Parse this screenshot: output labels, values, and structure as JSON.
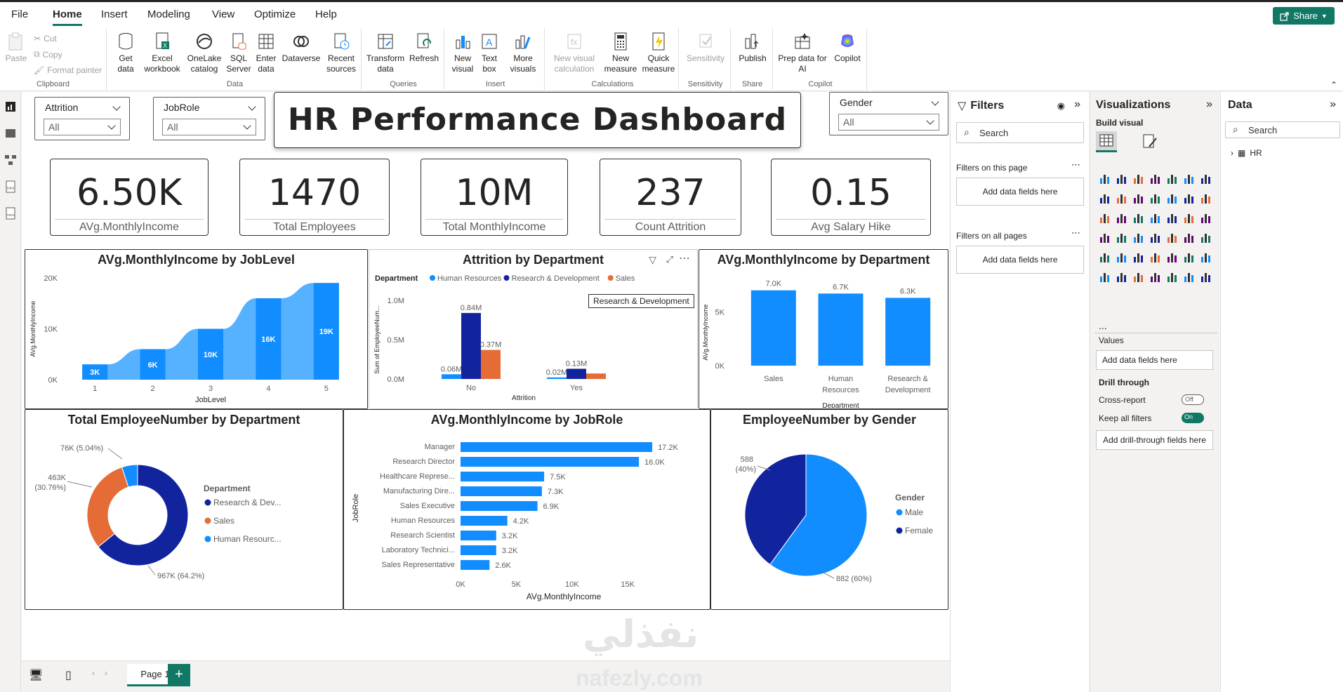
{
  "menu": {
    "items": [
      "File",
      "Home",
      "Insert",
      "Modeling",
      "View",
      "Optimize",
      "Help"
    ],
    "active": "Home",
    "share": "Share"
  },
  "ribbon": {
    "clipboard": {
      "label": "Clipboard",
      "paste": "Paste",
      "cut": "Cut",
      "copy": "Copy",
      "format_painter": "Format painter"
    },
    "data": {
      "label": "Data",
      "get_data": "Get data",
      "excel": "Excel workbook",
      "onelake": "OneLake catalog",
      "sql": "SQL Server",
      "enter": "Enter data",
      "dataverse": "Dataverse",
      "recent": "Recent sources"
    },
    "queries": {
      "label": "Queries",
      "transform": "Transform data",
      "refresh": "Refresh"
    },
    "insert": {
      "label": "Insert",
      "new_visual": "New visual",
      "text_box": "Text box",
      "more_visuals": "More visuals"
    },
    "calculations": {
      "label": "Calculations",
      "new_visual_calc": "New visual calculation",
      "new_measure": "New measure",
      "quick_measure": "Quick measure"
    },
    "sensitivity": {
      "label": "Sensitivity",
      "sensitivity": "Sensitivity"
    },
    "share": {
      "label": "Share",
      "publish": "Publish"
    },
    "copilot": {
      "label": "Copilot",
      "prep": "Prep data for AI",
      "copilot": "Copilot"
    }
  },
  "slicers": {
    "attrition": {
      "title": "Attrition",
      "value": "All"
    },
    "jobrole": {
      "title": "JobRole",
      "value": "All"
    },
    "gender": {
      "title": "Gender",
      "value": "All"
    }
  },
  "dashboard_title": "HR Performance Dashboard",
  "kpis": [
    {
      "value": "6.50K",
      "label": "AVg.MonthlyIncome"
    },
    {
      "value": "1470",
      "label": "Total Employees"
    },
    {
      "value": "10M",
      "label": "Total MonthlyIncome"
    },
    {
      "value": "237",
      "label": "Count Attrition"
    },
    {
      "value": "0.15",
      "label": "Avg Salary Hike"
    }
  ],
  "chart_data": [
    {
      "type": "area",
      "title": "AVg.MonthlyIncome by JobLevel",
      "xlabel": "JobLevel",
      "ylabel": "AVg.MonthlyIncome",
      "categories": [
        "1",
        "2",
        "3",
        "4",
        "5"
      ],
      "values": [
        3,
        6,
        10,
        16,
        19
      ],
      "data_labels": [
        "3K",
        "6K",
        "10K",
        "16K",
        "19K"
      ],
      "yticks": [
        "0K",
        "10K",
        "20K"
      ],
      "ylim": [
        0,
        20
      ]
    },
    {
      "type": "bar",
      "title": "Attrition by Department",
      "xlabel": "Attrition",
      "ylabel": "Sum of EmployeeNum...",
      "legend_title": "Department",
      "categories": [
        "No",
        "Yes"
      ],
      "series": [
        {
          "name": "Human Resources",
          "values": [
            0.06,
            0.02
          ],
          "labels": [
            "0.06M",
            "0.02M"
          ]
        },
        {
          "name": "Research & Development",
          "values": [
            0.84,
            0.13
          ],
          "labels": [
            "0.84M",
            "0.13M"
          ]
        },
        {
          "name": "Sales",
          "values": [
            0.37,
            0.07
          ],
          "labels": [
            "0.37M",
            ""
          ]
        }
      ],
      "yticks": [
        "0.0M",
        "0.5M",
        "1.0M"
      ],
      "ylim": [
        0,
        1.0
      ],
      "tooltip": "Research & Development"
    },
    {
      "type": "bar",
      "title": "AVg.MonthlyIncome by Department",
      "xlabel": "Department",
      "ylabel": "AVg.MonthlyIncome",
      "categories": [
        "Sales",
        "Human Resources",
        "Research & Development"
      ],
      "values": [
        7.0,
        6.7,
        6.3
      ],
      "data_labels": [
        "7.0K",
        "6.7K",
        "6.3K"
      ],
      "yticks": [
        "0K",
        "5K"
      ],
      "ylim": [
        0,
        7.5
      ]
    },
    {
      "type": "pie",
      "title": "Total EmployeeNumber by Department",
      "legend_title": "Department",
      "slices": [
        {
          "name": "Research & Dev...",
          "value": 967,
          "label": "967K (64.2%)"
        },
        {
          "name": "Sales",
          "value": 463,
          "label": "463K (30.76%)"
        },
        {
          "name": "Human Resourc...",
          "value": 76,
          "label": "76K (5.04%)"
        }
      ],
      "donut": true
    },
    {
      "type": "bar",
      "title": "AVg.MonthlyIncome by JobRole",
      "xlabel": "AVg.MonthlyIncome",
      "ylabel": "JobRole",
      "orientation": "horizontal",
      "categories": [
        "Manager",
        "Research Director",
        "Healthcare Represe...",
        "Manufacturing Dire...",
        "Sales Executive",
        "Human Resources",
        "Research Scientist",
        "Laboratory Technici...",
        "Sales Representative"
      ],
      "values": [
        17.2,
        16.0,
        7.5,
        7.3,
        6.9,
        4.2,
        3.2,
        3.2,
        2.6
      ],
      "data_labels": [
        "17.2K",
        "16.0K",
        "7.5K",
        "7.3K",
        "6.9K",
        "4.2K",
        "3.2K",
        "3.2K",
        "2.6K"
      ],
      "xticks": [
        "0K",
        "5K",
        "10K",
        "15K"
      ],
      "xlim": [
        0,
        20
      ]
    },
    {
      "type": "pie",
      "title": "EmployeeNumber by Gender",
      "legend_title": "Gender",
      "slices": [
        {
          "name": "Male",
          "value": 882,
          "label": "882 (60%)"
        },
        {
          "name": "Female",
          "value": 588,
          "label": "588 (40%)"
        }
      ]
    }
  ],
  "colors": {
    "blue": "#118dff",
    "dark_blue": "#12239e",
    "orange": "#e66c37",
    "mid_blue": "#44a9ff",
    "teal": "#117865"
  },
  "filters": {
    "title": "Filters",
    "search": "Search",
    "on_page": "Filters on this page",
    "on_all": "Filters on all pages",
    "add_fields": "Add data fields here"
  },
  "viz": {
    "title": "Visualizations",
    "build": "Build visual",
    "values": "Values",
    "add_fields": "Add data fields here",
    "drill": "Drill through",
    "cross": "Cross-report",
    "cross_state": "Off",
    "keep": "Keep all filters",
    "keep_state": "On",
    "add_drill": "Add drill-through fields here",
    "more": "..."
  },
  "data_pane": {
    "title": "Data",
    "search": "Search",
    "table": "HR"
  },
  "bottom": {
    "page": "Page 1",
    "add": "+"
  },
  "watermark": {
    "ar": "نفذلي",
    "en": "nafezly.com"
  }
}
